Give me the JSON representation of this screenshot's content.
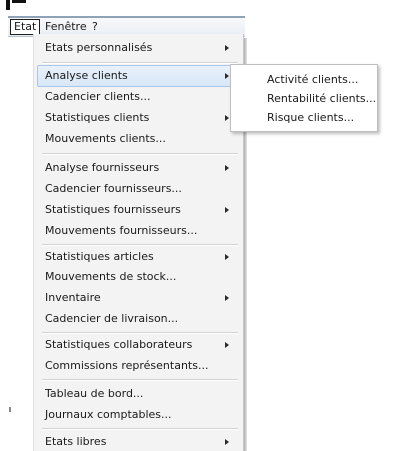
{
  "menubar": {
    "items": [
      {
        "label": "Etat"
      },
      {
        "label": "Fenêtre"
      },
      {
        "label": "?"
      }
    ]
  },
  "menu": {
    "items": [
      {
        "label": "Etats personnalisés",
        "submenu": true
      },
      {
        "label": "Analyse clients",
        "submenu": true,
        "highlighted": true
      },
      {
        "label": "Cadencier clients...",
        "submenu": false
      },
      {
        "label": "Statistiques clients",
        "submenu": true
      },
      {
        "label": "Mouvements clients...",
        "submenu": false
      },
      {
        "label": "Analyse fournisseurs",
        "submenu": true
      },
      {
        "label": "Cadencier fournisseurs...",
        "submenu": false
      },
      {
        "label": "Statistiques fournisseurs",
        "submenu": true
      },
      {
        "label": "Mouvements fournisseurs...",
        "submenu": false
      },
      {
        "label": "Statistiques articles",
        "submenu": true
      },
      {
        "label": "Mouvements de stock...",
        "submenu": false
      },
      {
        "label": "Inventaire",
        "submenu": true
      },
      {
        "label": "Cadencier de livraison...",
        "submenu": false
      },
      {
        "label": "Statistiques collaborateurs",
        "submenu": true
      },
      {
        "label": "Commissions représentants...",
        "submenu": false
      },
      {
        "label": "Tableau de bord...",
        "submenu": false
      },
      {
        "label": "Journaux comptables...",
        "submenu": false
      },
      {
        "label": "Etats libres",
        "submenu": true
      }
    ]
  },
  "submenu": {
    "items": [
      {
        "label": "Activité clients..."
      },
      {
        "label": "Rentabilité clients..."
      },
      {
        "label": "Risque clients..."
      }
    ]
  }
}
